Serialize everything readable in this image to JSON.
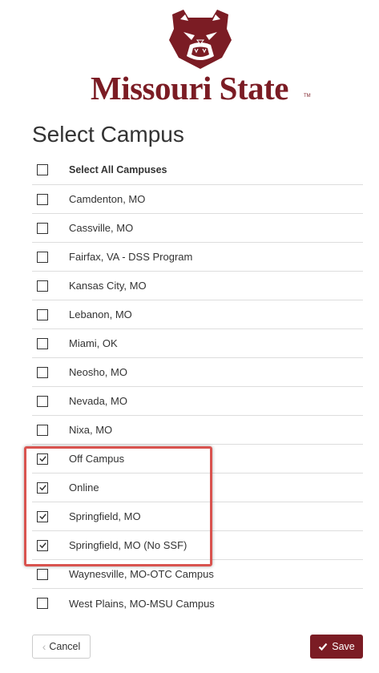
{
  "brand": {
    "name": "Missouri State",
    "trademark": "TM",
    "color": "#7b1c24",
    "logo_icon": "bear-head-icon"
  },
  "page": {
    "title": "Select Campus"
  },
  "campus_list": {
    "select_all": {
      "label": "Select All Campuses",
      "checked": false
    },
    "items": [
      {
        "label": "Camdenton, MO",
        "checked": false
      },
      {
        "label": "Cassville, MO",
        "checked": false
      },
      {
        "label": "Fairfax, VA - DSS Program",
        "checked": false
      },
      {
        "label": "Kansas City, MO",
        "checked": false
      },
      {
        "label": "Lebanon, MO",
        "checked": false
      },
      {
        "label": "Miami, OK",
        "checked": false
      },
      {
        "label": "Neosho, MO",
        "checked": false
      },
      {
        "label": "Nevada, MO",
        "checked": false
      },
      {
        "label": "Nixa, MO",
        "checked": false
      },
      {
        "label": "Off Campus",
        "checked": true
      },
      {
        "label": "Online",
        "checked": true
      },
      {
        "label": "Springfield, MO",
        "checked": true
      },
      {
        "label": "Springfield, MO (No SSF)",
        "checked": true
      },
      {
        "label": "Waynesville, MO-OTC Campus",
        "checked": false
      },
      {
        "label": "West Plains, MO-MSU Campus",
        "checked": false
      }
    ]
  },
  "annotation": {
    "highlight_color": "#d9534f"
  },
  "footer": {
    "cancel_label": "Cancel",
    "cancel_icon": "chevron-left-icon",
    "save_label": "Save",
    "save_icon": "checkmark-icon"
  }
}
